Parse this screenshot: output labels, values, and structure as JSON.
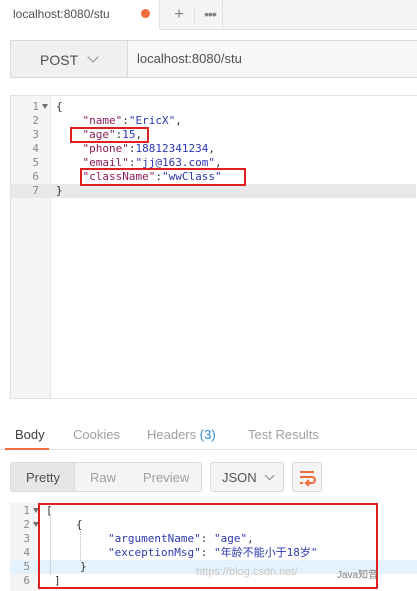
{
  "tab": {
    "title": "localhost:8080/stu",
    "unsaved_dot_color": "#f26b3a"
  },
  "request": {
    "method": "POST",
    "url": "localhost:8080/stu"
  },
  "request_body": {
    "line_numbers": [
      "1",
      "2",
      "3",
      "4",
      "5",
      "6",
      "7"
    ],
    "lines": [
      {
        "text": "{"
      },
      {
        "key": "\"name\"",
        "value": "\"EricX\"",
        "tail": ","
      },
      {
        "key": "\"age\"",
        "value": "15",
        "tail": ","
      },
      {
        "key": "\"phone\"",
        "value": "18812341234",
        "tail": ","
      },
      {
        "key": "\"email\"",
        "value": "\"jj@163.com\"",
        "tail": ","
      },
      {
        "key": "\"className\"",
        "value": "\"wwClass\"",
        "tail": ""
      },
      {
        "text": "}"
      }
    ]
  },
  "response_tabs": {
    "body": "Body",
    "cookies": "Cookies",
    "headers": "Headers",
    "headers_count": "(3)",
    "test_results": "Test Results"
  },
  "response_toolbar": {
    "pretty": "Pretty",
    "raw": "Raw",
    "preview": "Preview",
    "format": "JSON",
    "wrap_icon": "wrap-lines-icon"
  },
  "response_body": {
    "line_numbers": [
      "1",
      "2",
      "3",
      "4",
      "5",
      "6"
    ],
    "l1": "[",
    "l2": "{",
    "l3_key": "\"argumentName\"",
    "l3_value": "\"age\"",
    "l4_key": "\"exceptionMsg\"",
    "l4_value": "\"年龄不能小于18岁\"",
    "l5": "}",
    "l6": "]"
  },
  "watermark": {
    "url_text": "https://blog.csdn.net/",
    "brand": "Java知音"
  },
  "colors": {
    "accent": "#f26b3a",
    "highlight_box": "#e02020",
    "json_key": "#8b1c5c",
    "json_string": "#2b37b0"
  }
}
